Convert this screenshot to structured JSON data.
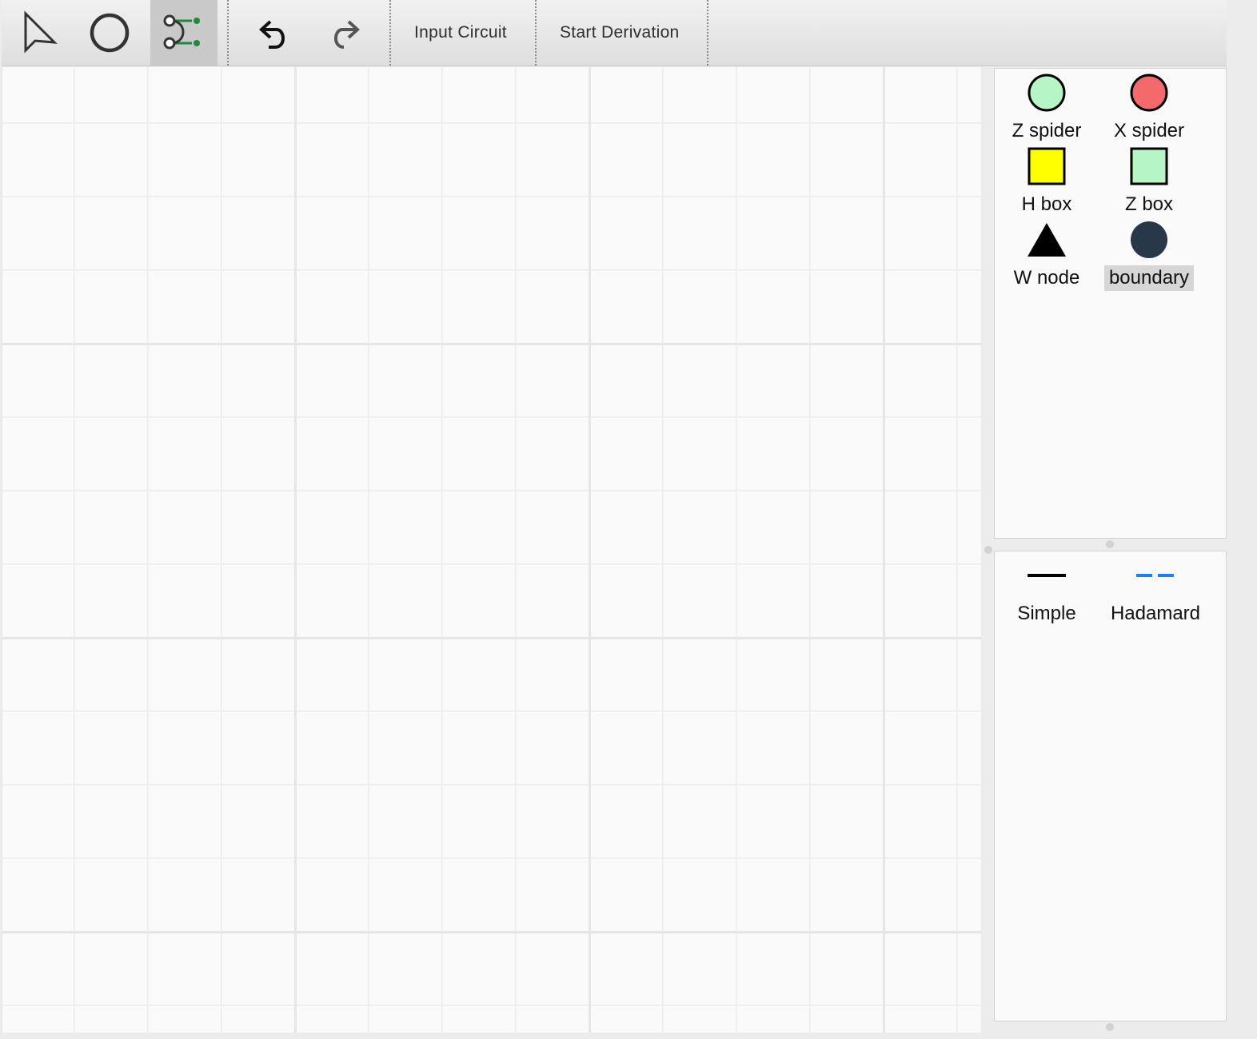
{
  "toolbar": {
    "tools": [
      {
        "name": "select-tool",
        "icon": "cursor-arrow-icon"
      },
      {
        "name": "vertex-tool",
        "icon": "circle-icon"
      },
      {
        "name": "edge-tool",
        "icon": "edge-connect-icon",
        "active": true
      }
    ],
    "undo_icon": "undo-icon",
    "redo_icon": "redo-icon",
    "input_circuit_label": "Input Circuit",
    "start_derivation_label": "Start Derivation"
  },
  "vertex_palette": {
    "items": [
      {
        "label": "Z spider",
        "shape": "circle",
        "color": "#b6f5c4"
      },
      {
        "label": "X spider",
        "shape": "circle",
        "color": "#f46a6a"
      },
      {
        "label": "H box",
        "shape": "square",
        "color": "#ffff00"
      },
      {
        "label": "Z box",
        "shape": "square",
        "color": "#b6f5c4"
      },
      {
        "label": "W node",
        "shape": "triangle",
        "color": "#000000"
      },
      {
        "label": "boundary",
        "shape": "circle",
        "color": "#283848",
        "selected": true
      }
    ]
  },
  "edge_palette": {
    "items": [
      {
        "label": "Simple",
        "style": "solid",
        "color": "#000000"
      },
      {
        "label": "Hadamard",
        "style": "dashed",
        "color": "#1e7fff"
      }
    ]
  }
}
